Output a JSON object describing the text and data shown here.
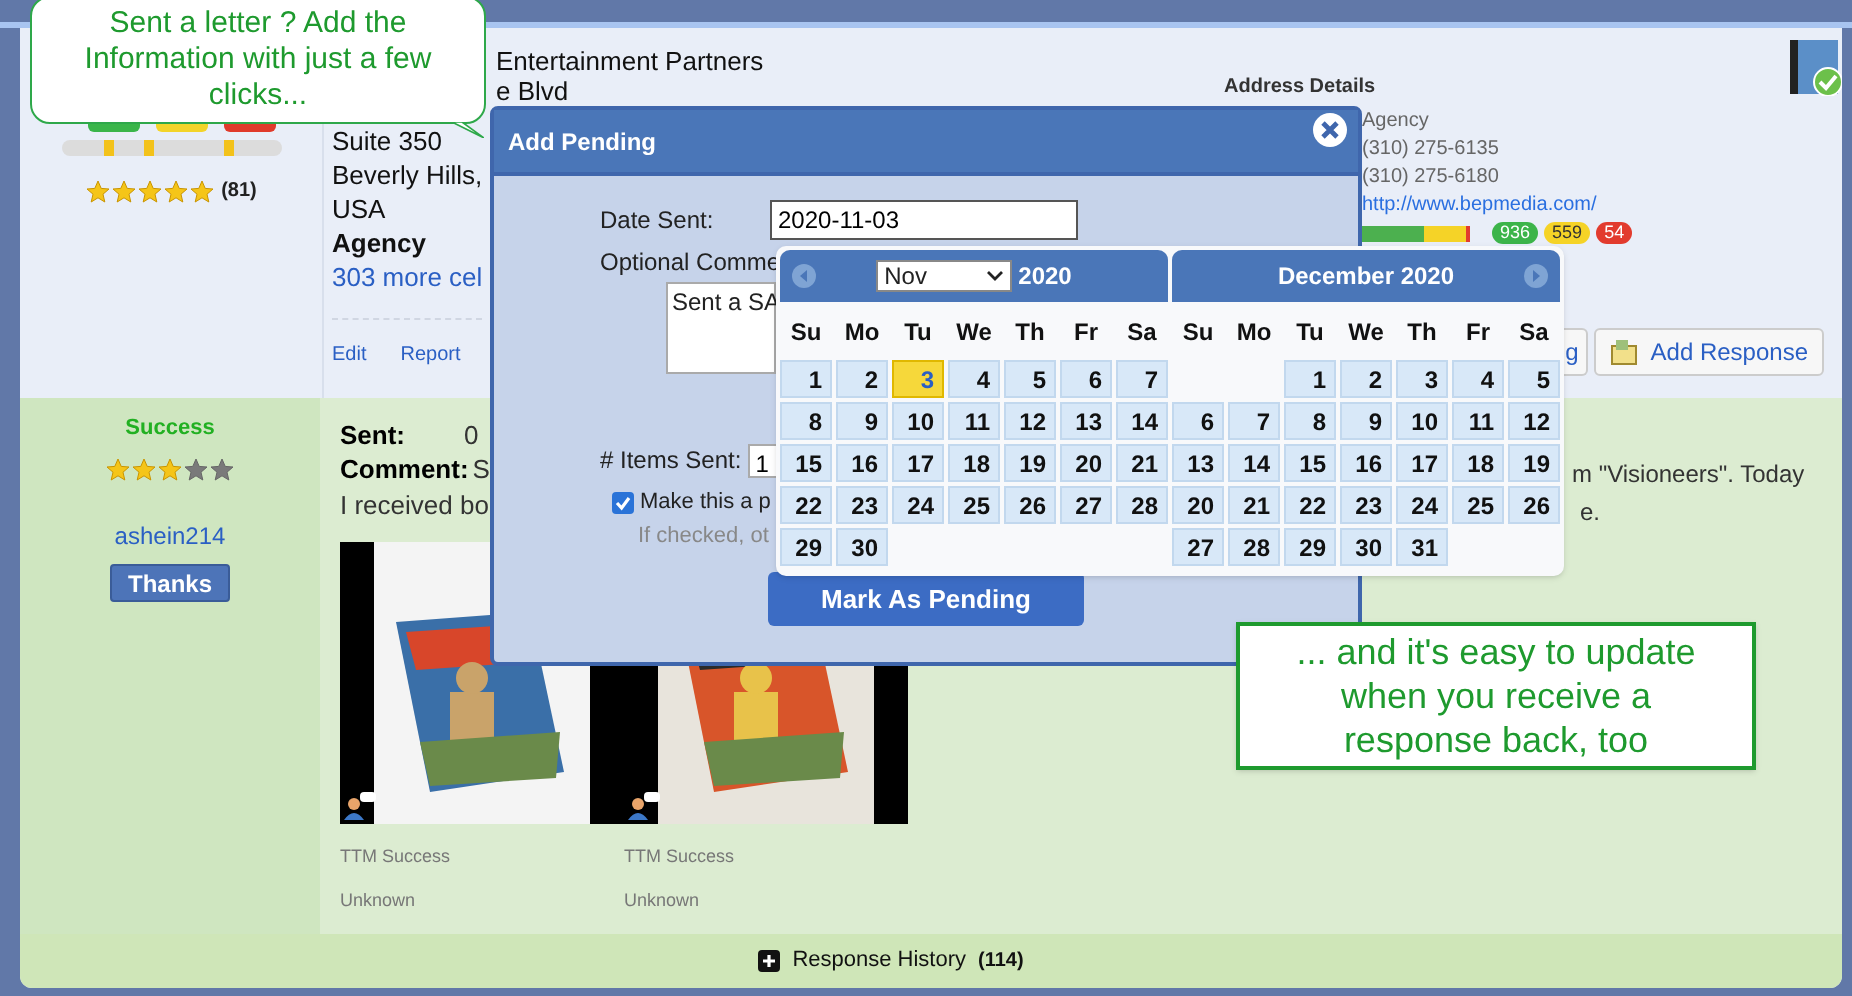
{
  "callout_top": {
    "text": "Sent a letter ? Add the Information with just a few clicks..."
  },
  "callout_bottom": {
    "text": "... and it's easy to update when you receive a response back, too"
  },
  "entry": {
    "rating": {
      "stars": 5,
      "count": "(81)"
    },
    "address_lines": [
      {
        "text": "Entertainment Partners",
        "kind": "offset"
      },
      {
        "text": "e Blvd",
        "kind": "offset"
      },
      {
        "text": "Suite 350",
        "kind": "plain"
      },
      {
        "text": "Beverly Hills,",
        "kind": "plain"
      },
      {
        "text": "USA",
        "kind": "plain"
      },
      {
        "text": "Agency",
        "kind": "bold"
      },
      {
        "text": "303 more cel",
        "kind": "link"
      }
    ],
    "links": [
      "Edit",
      "Report"
    ],
    "details_title": "Address Details",
    "details": [
      {
        "text": "Agency",
        "kind": "plain"
      },
      {
        "text": "(310) 275-6135",
        "kind": "plain"
      },
      {
        "text": "(310) 275-6180",
        "kind": "plain"
      },
      {
        "text": "http://www.bepmedia.com/",
        "kind": "link"
      }
    ],
    "badges": [
      {
        "text": "936",
        "color": "#3cb44a"
      },
      {
        "text": "559",
        "color": "#f5d327"
      },
      {
        "text": "54",
        "color": "#e23b2e"
      }
    ],
    "buttons": [
      {
        "label": "g",
        "kind": "partial"
      },
      {
        "label": "Add Response",
        "kind": "icon"
      }
    ]
  },
  "response": {
    "status": "Success",
    "stars": 3,
    "user": "ashein214",
    "thanks": "Thanks",
    "sent_label": "Sent:",
    "sent_value": "0",
    "comment_label": "Comment:",
    "comment_value": "S",
    "text": "I received bo",
    "right_text": [
      "m \"Visioneers\". Today",
      "e."
    ],
    "photos": [
      {
        "kind": "picture",
        "caption": "TTM Success",
        "note": "Unknown"
      },
      {
        "kind": "picture",
        "caption": "TTM Success",
        "note": "Unknown"
      }
    ]
  },
  "footer": {
    "label": "Response History",
    "count": "(114)"
  },
  "dialog": {
    "title": "Add Pending",
    "date_label": "Date Sent:",
    "date_value": "2020-11-03",
    "comment_label": "Optional Comme",
    "comment_value": "Sent a SA",
    "items_label": "# Items Sent:",
    "items_value": "1",
    "checkbox": {
      "label": "Make this a p",
      "checked": true
    },
    "hint": "If checked, ot",
    "submit": "Mark As Pending"
  },
  "calendar": {
    "months": [
      {
        "month_select": "Nov",
        "year": "2020",
        "weekdays": [
          "Su",
          "Mo",
          "Tu",
          "We",
          "Th",
          "Fr",
          "Sa"
        ],
        "weeks": [
          {
            "kind": "first",
            "days": [
              {
                "day": "1",
                "selected": false
              },
              {
                "day": "2",
                "selected": false
              },
              {
                "day": "3",
                "selected": true
              },
              {
                "day": "4",
                "selected": false
              },
              {
                "day": "5",
                "selected": false
              },
              {
                "day": "6",
                "selected": false
              },
              {
                "day": "7",
                "selected": false
              }
            ]
          },
          {
            "kind": "full",
            "days": [
              {
                "day": "8",
                "selected": false
              },
              {
                "day": "9",
                "selected": false
              },
              {
                "day": "10",
                "selected": false
              },
              {
                "day": "11",
                "selected": false
              },
              {
                "day": "12",
                "selected": false
              },
              {
                "day": "13",
                "selected": false
              },
              {
                "day": "14",
                "selected": false
              }
            ]
          },
          {
            "kind": "full",
            "days": [
              {
                "day": "15",
                "selected": false
              },
              {
                "day": "16",
                "selected": false
              },
              {
                "day": "17",
                "selected": false
              },
              {
                "day": "18",
                "selected": false
              },
              {
                "day": "19",
                "selected": false
              },
              {
                "day": "20",
                "selected": false
              },
              {
                "day": "21",
                "selected": false
              }
            ]
          },
          {
            "kind": "full",
            "days": [
              {
                "day": "22",
                "selected": false
              },
              {
                "day": "23",
                "selected": false
              },
              {
                "day": "24",
                "selected": false
              },
              {
                "day": "25",
                "selected": false
              },
              {
                "day": "26",
                "selected": false
              },
              {
                "day": "27",
                "selected": false
              },
              {
                "day": "28",
                "selected": false
              }
            ]
          },
          {
            "kind": "last",
            "days": [
              {
                "day": "29",
                "selected": false
              },
              {
                "day": "30",
                "selected": false
              }
            ]
          }
        ]
      },
      {
        "title": "December 2020",
        "weekdays": [
          "Su",
          "Mo",
          "Tu",
          "We",
          "Th",
          "Fr",
          "Sa"
        ],
        "weeks": [
          {
            "kind": "first",
            "days": [
              {
                "day": "1",
                "selected": false
              },
              {
                "day": "2",
                "selected": false
              },
              {
                "day": "3",
                "selected": false
              },
              {
                "day": "4",
                "selected": false
              },
              {
                "day": "5",
                "selected": false
              }
            ]
          },
          {
            "kind": "full",
            "days": [
              {
                "day": "6",
                "selected": false
              },
              {
                "day": "7",
                "selected": false
              },
              {
                "day": "8",
                "selected": false
              },
              {
                "day": "9",
                "selected": false
              },
              {
                "day": "10",
                "selected": false
              },
              {
                "day": "11",
                "selected": false
              },
              {
                "day": "12",
                "selected": false
              }
            ]
          },
          {
            "kind": "full",
            "days": [
              {
                "day": "13",
                "selected": false
              },
              {
                "day": "14",
                "selected": false
              },
              {
                "day": "15",
                "selected": false
              },
              {
                "day": "16",
                "selected": false
              },
              {
                "day": "17",
                "selected": false
              },
              {
                "day": "18",
                "selected": false
              },
              {
                "day": "19",
                "selected": false
              }
            ]
          },
          {
            "kind": "full",
            "days": [
              {
                "day": "20",
                "selected": false
              },
              {
                "day": "21",
                "selected": false
              },
              {
                "day": "22",
                "selected": false
              },
              {
                "day": "23",
                "selected": false
              },
              {
                "day": "24",
                "selected": false
              },
              {
                "day": "25",
                "selected": false
              },
              {
                "day": "26",
                "selected": false
              }
            ]
          },
          {
            "kind": "last",
            "days": [
              {
                "day": "27",
                "selected": false
              },
              {
                "day": "28",
                "selected": false
              },
              {
                "day": "29",
                "selected": false
              },
              {
                "day": "30",
                "selected": false
              },
              {
                "day": "31",
                "selected": false
              }
            ]
          }
        ]
      }
    ]
  }
}
